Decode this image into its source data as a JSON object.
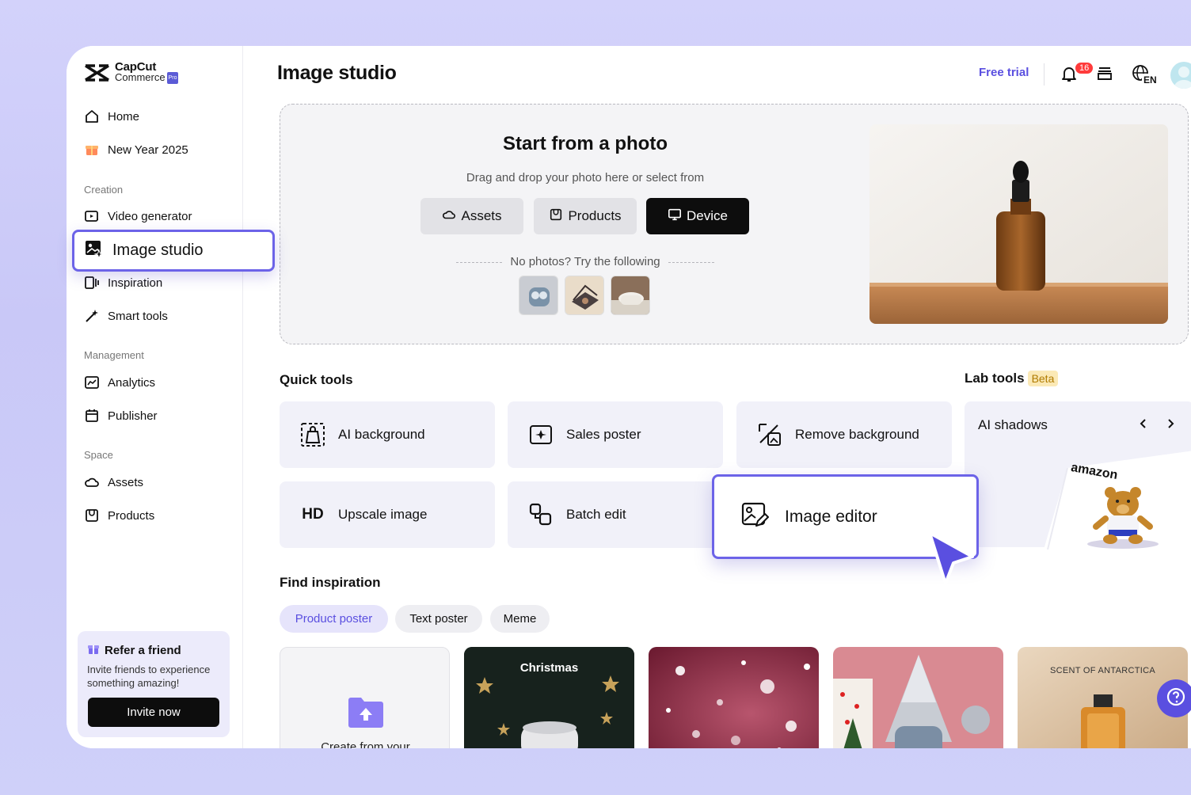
{
  "brand": {
    "line1": "CapCut",
    "line2": "Commerce",
    "tag": "Pro"
  },
  "sidebar": {
    "items_top": [
      {
        "label": "Home",
        "icon": "home-icon"
      },
      {
        "label": "New Year 2025",
        "icon": "gift-icon"
      }
    ],
    "creation_label": "Creation",
    "creation": [
      {
        "label": "Video generator",
        "icon": "video-generator-icon"
      },
      {
        "label": "Image studio",
        "icon": "image-studio-icon",
        "active": true
      },
      {
        "label": "Inspiration",
        "icon": "inspiration-icon"
      },
      {
        "label": "Smart tools",
        "icon": "magic-wand-icon"
      }
    ],
    "management_label": "Management",
    "management": [
      {
        "label": "Analytics",
        "icon": "analytics-icon"
      },
      {
        "label": "Publisher",
        "icon": "calendar-icon"
      }
    ],
    "space_label": "Space",
    "space": [
      {
        "label": "Assets",
        "icon": "cloud-icon"
      },
      {
        "label": "Products",
        "icon": "product-box-icon"
      }
    ],
    "refer": {
      "title": "Refer a friend",
      "desc": "Invite friends to experience something amazing!",
      "button": "Invite now"
    }
  },
  "header": {
    "title": "Image studio",
    "free_trial": "Free trial",
    "notification_count": "16",
    "language": "EN"
  },
  "upload": {
    "title": "Start from a photo",
    "subtitle": "Drag and drop your photo here or select from",
    "buttons": [
      "Assets",
      "Products",
      "Device"
    ],
    "try_text": "No photos? Try the following"
  },
  "quick_tools": {
    "title": "Quick tools",
    "tools": [
      {
        "label": "AI background",
        "icon": "ai-background-icon"
      },
      {
        "label": "Sales poster",
        "icon": "sales-poster-icon"
      },
      {
        "label": "Remove background",
        "icon": "remove-background-icon"
      },
      {
        "label": "Upscale image",
        "icon": "hd-icon",
        "icon_text": "HD"
      },
      {
        "label": "Batch edit",
        "icon": "batch-edit-icon"
      },
      {
        "label": "Image editor",
        "icon": "image-editor-icon"
      }
    ]
  },
  "lab_tools": {
    "title": "Lab tools",
    "badge": "Beta",
    "card_title": "AI shadows",
    "card_brand": "amazon"
  },
  "inspiration": {
    "title": "Find inspiration",
    "tabs": [
      "Product poster",
      "Text poster",
      "Meme"
    ],
    "create_label": "Create from your",
    "cards": [
      {
        "caption": "Christmas"
      },
      {
        "caption": ""
      },
      {
        "caption": ""
      },
      {
        "caption": "SCENT OF ANTARCTICA"
      }
    ]
  },
  "colors": {
    "accent": "#5a4fe0",
    "highlight_border": "#6c63e8"
  }
}
